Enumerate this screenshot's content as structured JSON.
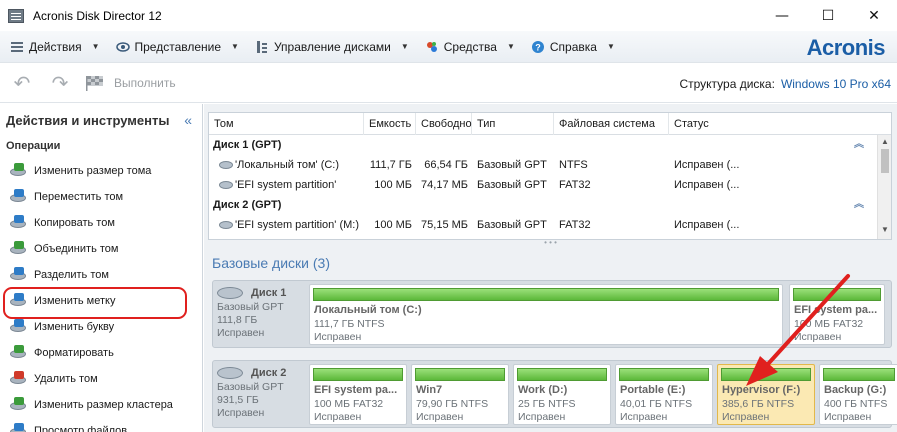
{
  "window": {
    "title": "Acronis Disk Director 12",
    "minimize": "—",
    "maximize": "☐",
    "close": "✕"
  },
  "menu": {
    "items": [
      {
        "label": "Действия",
        "icon": "actions-icon"
      },
      {
        "label": "Представление",
        "icon": "eye-icon"
      },
      {
        "label": "Управление дисками",
        "icon": "disk-management-icon"
      },
      {
        "label": "Средства",
        "icon": "tools-icon"
      },
      {
        "label": "Справка",
        "icon": "help-icon"
      }
    ],
    "brand": "Acronis"
  },
  "toolbar": {
    "run_label": "Выполнить",
    "disk_structure_label": "Структура диска:",
    "disk_structure_value": "Windows 10 Pro x64"
  },
  "leftpanel": {
    "title": "Действия и инструменты",
    "collapse": "«",
    "section": "Операции",
    "operations": [
      {
        "label": "Изменить размер тома",
        "icon": "resize-volume-icon"
      },
      {
        "label": "Переместить том",
        "icon": "move-volume-icon"
      },
      {
        "label": "Копировать том",
        "icon": "copy-volume-icon"
      },
      {
        "label": "Объединить том",
        "icon": "merge-volume-icon"
      },
      {
        "label": "Разделить том",
        "icon": "split-volume-icon"
      },
      {
        "label": "Изменить метку",
        "icon": "change-label-icon"
      },
      {
        "label": "Изменить букву",
        "icon": "change-letter-icon"
      },
      {
        "label": "Форматировать",
        "icon": "format-icon"
      },
      {
        "label": "Удалить том",
        "icon": "delete-volume-icon"
      },
      {
        "label": "Изменить размер кластера",
        "icon": "cluster-size-icon"
      },
      {
        "label": "Просмотр файлов",
        "icon": "browse-files-icon"
      }
    ]
  },
  "table": {
    "columns": [
      "Том",
      "Емкость",
      "Свободно",
      "Тип",
      "Файловая система",
      "Статус"
    ],
    "groups": [
      {
        "title": "Диск 1 (GPT)",
        "rows": [
          [
            "'Локальный том' (C:)",
            "111,7 ГБ",
            "66,54 ГБ",
            "Базовый GPT",
            "NTFS",
            "Исправен (..."
          ],
          [
            "'EFI system partition'",
            "100 МБ",
            "74,17 МБ",
            "Базовый GPT",
            "FAT32",
            "Исправен (..."
          ]
        ]
      },
      {
        "title": "Диск 2 (GPT)",
        "rows": [
          [
            "'EFI system partition' (M:)",
            "100 МБ",
            "75,15 МБ",
            "Базовый GPT",
            "FAT32",
            "Исправен (..."
          ]
        ]
      }
    ]
  },
  "basic_disks_title": "Базовые диски (3)",
  "disks": [
    {
      "name": "Диск 1",
      "type": "Базовый GPT",
      "size": "111,8 ГБ",
      "status": "Исправен",
      "partitions": [
        {
          "name": "Локальный том (C:)",
          "info": "111,7 ГБ NTFS",
          "status": "Исправен"
        },
        {
          "name": "EFI system pa...",
          "info": "100 МБ FAT32",
          "status": "Исправен"
        }
      ]
    },
    {
      "name": "Диск 2",
      "type": "Базовый GPT",
      "size": "931,5 ГБ",
      "status": "Исправен",
      "partitions": [
        {
          "name": "EFI system pa...",
          "info": "100 МБ FAT32",
          "status": "Исправен"
        },
        {
          "name": "Win7",
          "info": "79,90 ГБ NTFS",
          "status": "Исправен"
        },
        {
          "name": "Work (D:)",
          "info": "25 ГБ NTFS",
          "status": "Исправен"
        },
        {
          "name": "Portable (E:)",
          "info": "40,01 ГБ NTFS",
          "status": "Исправен"
        },
        {
          "name": "Hypervisor (F:)",
          "info": "385,6 ГБ NTFS",
          "status": "Исправен"
        },
        {
          "name": "Backup (G:)",
          "info": "400 ГБ NTFS",
          "status": "Исправен"
        }
      ]
    }
  ],
  "colors": {
    "accent": "#1b5ea6",
    "highlight": "#e0201e",
    "partition_bar": "#5cb83a",
    "selected_partition": "#fbe9b3"
  }
}
